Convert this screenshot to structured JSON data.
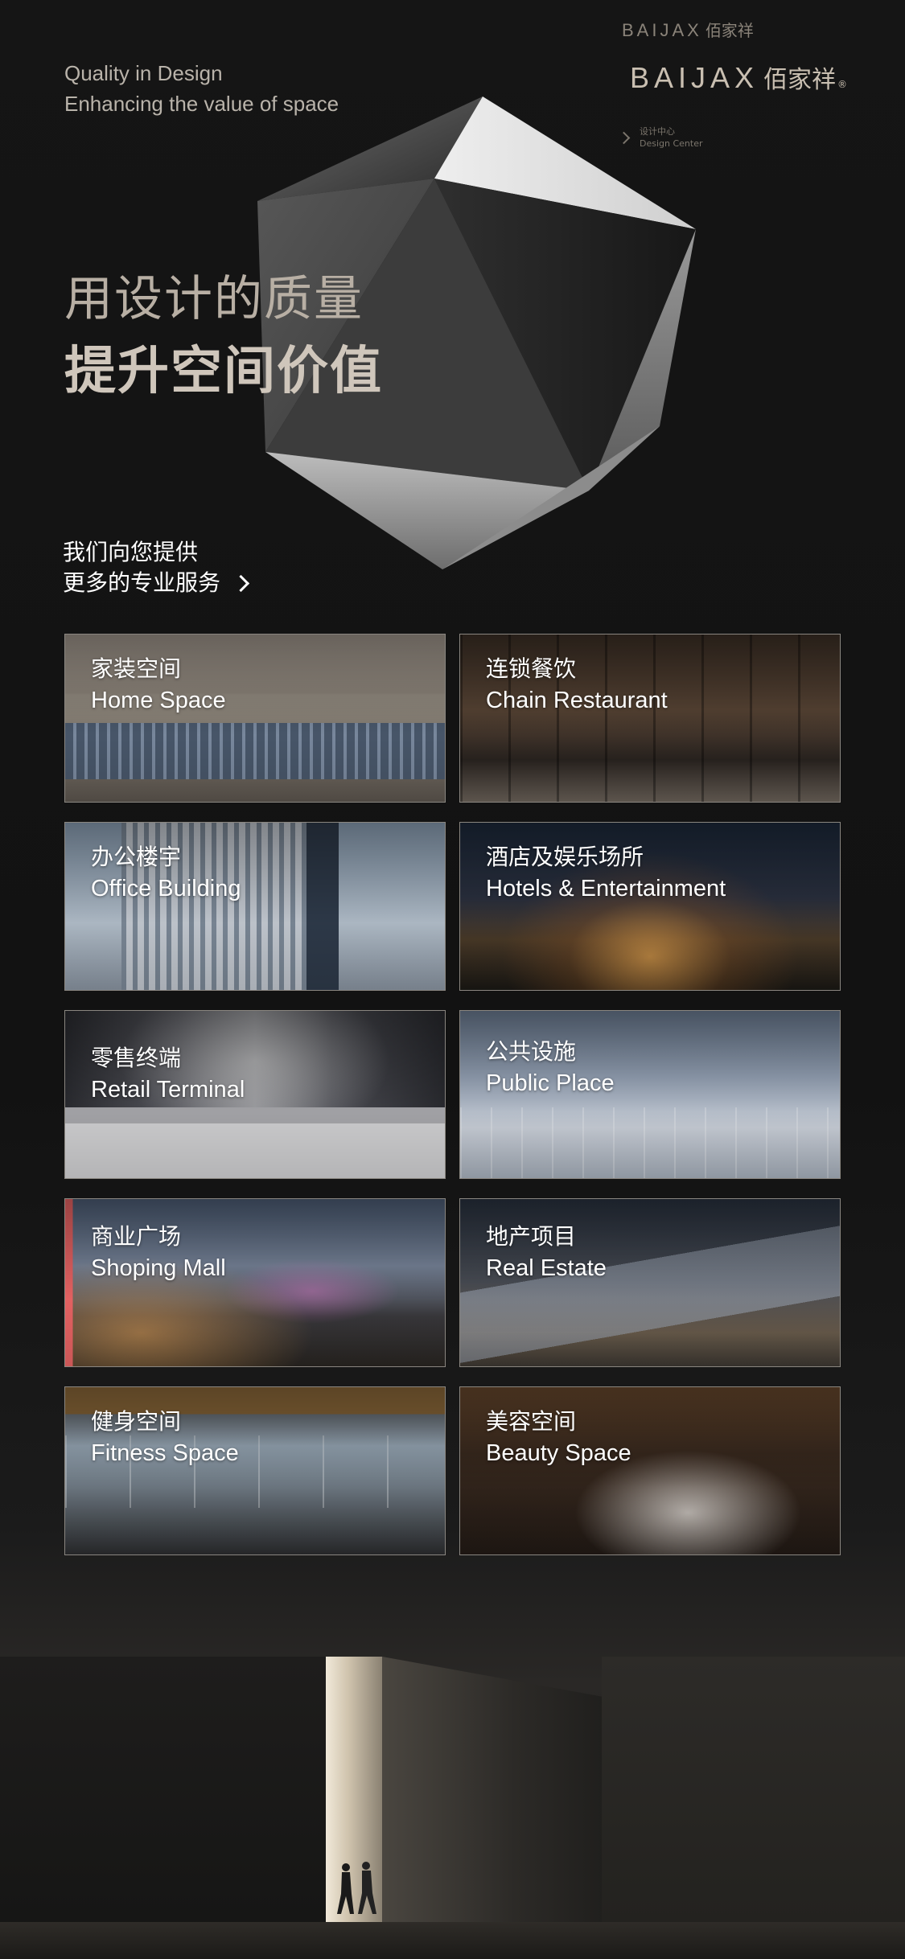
{
  "header": {
    "tagline_line1": "Quality in Design",
    "tagline_line2": "Enhancing the value of space",
    "brand_latin": "BAIJAX",
    "brand_cn": "佰家祥",
    "brand_reg": "®"
  },
  "hero": {
    "title_line1": "用设计的质量",
    "title_line2": "提升空间价值"
  },
  "intro": {
    "line1": "我们向您提供",
    "line2": "更多的专业服务"
  },
  "services": [
    {
      "cn": "家装空间",
      "en": "Home Space"
    },
    {
      "cn": "连锁餐饮",
      "en": "Chain Restaurant"
    },
    {
      "cn": "办公楼宇",
      "en": "Office Building"
    },
    {
      "cn": "酒店及娱乐场所",
      "en": "Hotels & Entertainment"
    },
    {
      "cn": "零售终端",
      "en": "Retail Terminal"
    },
    {
      "cn": "公共设施",
      "en": "Public Place"
    },
    {
      "cn": "商业广场",
      "en": "Shoping Mall"
    },
    {
      "cn": "地产项目",
      "en": "Real Estate"
    },
    {
      "cn": "健身空间",
      "en": "Fitness Space"
    },
    {
      "cn": "美容空间",
      "en": "Beauty Space"
    }
  ],
  "footer": {
    "sign_brand_latin": "BAIJAX",
    "sign_brand_cn": "佰家祥",
    "design_center_cn": "设计中心",
    "design_center_en": "Design Center"
  },
  "colors": {
    "background": "#141414",
    "accent_gold": "#c9bfb1",
    "card_border": "#8a8680"
  },
  "icons": [
    "chevron-right-icon",
    "polyhedron-graphic"
  ]
}
